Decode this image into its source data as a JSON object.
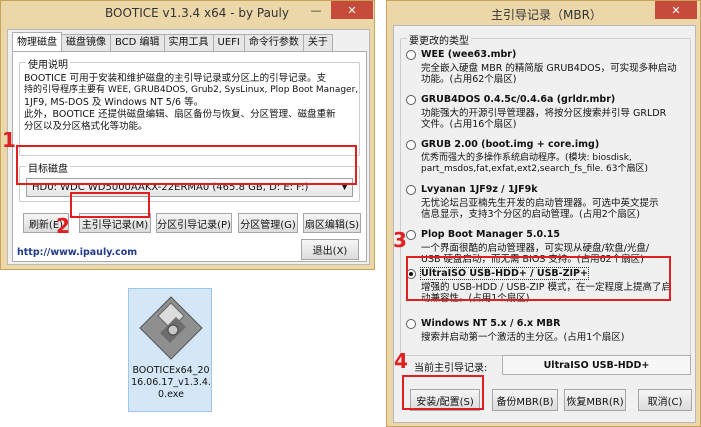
{
  "left_window": {
    "title": "BOOTICE v1.3.4 x64 - by Pauly",
    "minimize": "—",
    "close": "✕",
    "tabs": [
      "物理磁盘",
      "磁盘镜像",
      "BCD 编辑",
      "实用工具",
      "UEFI",
      "命令行参数",
      "关于"
    ],
    "usage_label": "使用说明",
    "usage_lines": [
      "BOOTICE 可用于安装和维护磁盘的主引导记录或分区上的引导记录。支",
      "持的引导程序主要有 WEE, GRUB4DOS, Grub2, SysLinux, Plop Boot Manager,",
      "1JF9, MS-DOS 及 Windows NT 5/6 等。",
      "此外，BOOTICE 还提供磁盘编辑、扇区备份与恢复、分区管理、磁盘重新",
      "分区以及分区格式化等功能。"
    ],
    "target_disk_label": "目标磁盘",
    "disk_selected": "HD0: WDC WD5000AAKX-22ERMA0 (465.8 GB, D: E: F:)",
    "buttons": {
      "refresh": "刷新(E)",
      "mbr": "主引导记录(M)",
      "pbr": "分区引导记录(P)",
      "parts": "分区管理(G)",
      "sector": "扇区编辑(S)",
      "exit": "退出(X)"
    },
    "website": "http://www.ipauly.com"
  },
  "desktop_file": {
    "icon": "floppy-disk-icon",
    "name_lines": [
      "BOOTICEx64_20",
      "16.06.17_v1.3.4.",
      "0.exe"
    ]
  },
  "right_window": {
    "title": "主引导记录（MBR）",
    "close": "✕",
    "group_label": "要更改的类型",
    "options": [
      {
        "title": "WEE (wee63.mbr)",
        "desc": [
          "完全嵌入硬盘 MBR 的精简版 GRUB4DOS，可实现多种启动",
          "功能。(占用62个扇区)"
        ],
        "selected": false
      },
      {
        "title": "GRUB4DOS 0.4.5c/0.4.6a (grldr.mbr)",
        "desc": [
          "功能强大的开源引导管理器，将按分区搜索并引导 GRLDR",
          "文件。(占用16个扇区)"
        ],
        "selected": false
      },
      {
        "title": "GRUB 2.00 (boot.img + core.img)",
        "desc": [
          "优秀而强大的多操作系统启动程序。(模块: biosdisk,",
          "part_msdos,fat,exfat,ext2,search_fs_file. 63个扇区)"
        ],
        "selected": false
      },
      {
        "title": "Lvyanan 1JF9z / 1JF9k",
        "desc": [
          "无忧论坛吕亚楠先生开发的启动管理器。可选中英文提示",
          "信息显示，支持3个分区的启动管理。(占用2个扇区)"
        ],
        "selected": false
      },
      {
        "title": "Plop Boot Manager 5.0.15",
        "desc": [
          "一个界面很酷的启动管理器，可实现从硬盘/软盘/光盘/",
          "USB 硬盘启动，而无需 BIOS 支持。(占用62个扇区)"
        ],
        "selected": false
      },
      {
        "title": "UltraISO USB-HDD+ / USB-ZIP+",
        "desc": [
          "增强的 USB-HDD / USB-ZIP 模式，在一定程度上提高了启",
          "动兼容性。(占用1个扇区)"
        ],
        "selected": true
      },
      {
        "title": "Windows NT 5.x / 6.x MBR",
        "desc": [
          "搜索并启动第一个激活的主分区。(占用1个扇区)"
        ],
        "selected": false
      }
    ],
    "current_label": "当前主引导记录:",
    "current_value": "UltraISO USB-HDD+",
    "buttons": {
      "install": "安装/配置(S)",
      "backup": "备份MBR(B)",
      "restore": "恢复MBR(R)",
      "cancel": "取消(C)"
    }
  },
  "annotations": [
    "1",
    "2",
    "3",
    "4"
  ],
  "colors": {
    "annotation_red": "#e02020",
    "window_frame": "#ecd7a9",
    "close_red": "#c74b3b"
  }
}
